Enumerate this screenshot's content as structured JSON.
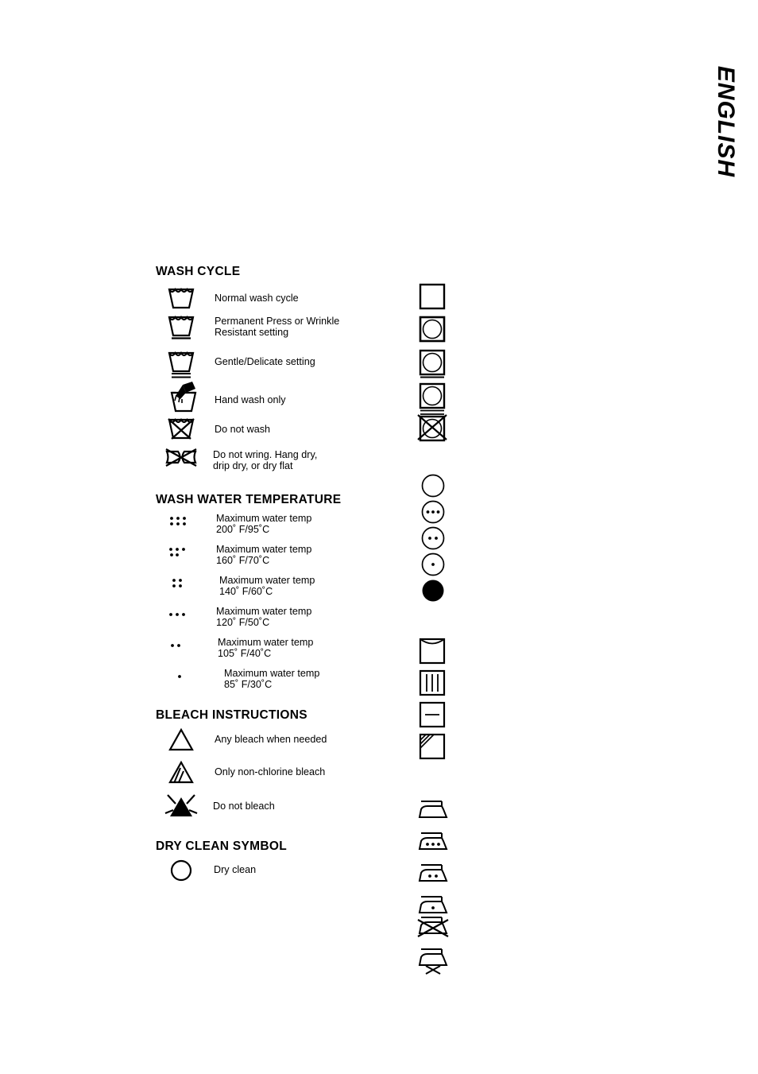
{
  "page": {
    "language_tab": "ENGLISH"
  },
  "sections": [
    {
      "id": "wash-cycle",
      "title": "WASH CYCLE",
      "entries": [
        {
          "icon": "washtub-icon",
          "label": "Normal wash cycle"
        },
        {
          "icon": "washtub-one-bar-icon",
          "label": "Permanent Press or Wrinkle",
          "label2": "Resistant setting"
        },
        {
          "icon": "washtub-two-bar-icon",
          "label": "Gentle/Delicate setting"
        },
        {
          "icon": "washtub-hand-icon",
          "label": "Hand wash only"
        },
        {
          "icon": "washtub-crossed-icon",
          "label": "Do not wash"
        },
        {
          "icon": "do-not-wring-icon",
          "label": "Do not wring. Hang dry,",
          "label2": "drip dry, or dry flat"
        }
      ]
    },
    {
      "id": "wash-water-temperature",
      "title": "WASH WATER TEMPERATURE",
      "entries": [
        {
          "icon": "six-dots-icon",
          "dots": 6,
          "label": "Maximum water temp",
          "label2": "200˚ F/95˚C"
        },
        {
          "icon": "five-dots-icon",
          "dots": 5,
          "label": "Maximum water temp",
          "label2": "160˚ F/70˚C"
        },
        {
          "icon": "four-dots-icon",
          "dots": 4,
          "label": "Maximum water temp",
          "label2": "140˚ F/60˚C"
        },
        {
          "icon": "three-dots-icon",
          "dots": 3,
          "label": "Maximum water temp",
          "label2": "120˚ F/50˚C"
        },
        {
          "icon": "two-dots-icon",
          "dots": 2,
          "label": "Maximum water temp",
          "label2": "105˚ F/40˚C"
        },
        {
          "icon": "one-dot-icon",
          "dots": 1,
          "label": "Maximum water temp",
          "label2": "85˚ F/30˚C"
        }
      ]
    },
    {
      "id": "bleach-instructions",
      "title": "BLEACH INSTRUCTIONS",
      "entries": [
        {
          "icon": "triangle-icon",
          "label": "Any bleach when needed"
        },
        {
          "icon": "triangle-striped-icon",
          "label": "Only non-chlorine bleach"
        },
        {
          "icon": "triangle-filled-icon",
          "label": "Do not bleach"
        }
      ]
    },
    {
      "id": "dry-clean-symbol",
      "title": "DRY CLEAN SYMBOL",
      "entries": [
        {
          "icon": "circle-icon",
          "label": "Dry clean"
        }
      ]
    }
  ],
  "right_column": {
    "tumble_dry": [
      {
        "icon": "square-icon"
      },
      {
        "icon": "tumble-dry-icon"
      },
      {
        "icon": "tumble-dry-one-bar-icon"
      },
      {
        "icon": "tumble-dry-two-bar-icon"
      },
      {
        "icon": "tumble-dry-crossed-icon"
      }
    ],
    "dry_clean": [
      {
        "icon": "dryclean-circle-icon"
      },
      {
        "icon": "dryclean-three-dots-icon",
        "dots": 3
      },
      {
        "icon": "dryclean-two-dots-icon",
        "dots": 2
      },
      {
        "icon": "dryclean-one-dot-icon",
        "dots": 1
      },
      {
        "icon": "dryclean-filled-icon"
      }
    ],
    "line_dry": [
      {
        "icon": "hang-dry-icon"
      },
      {
        "icon": "drip-dry-icon"
      },
      {
        "icon": "dry-flat-icon"
      },
      {
        "icon": "dry-in-shade-icon"
      }
    ],
    "ironing": [
      {
        "icon": "iron-icon"
      },
      {
        "icon": "iron-three-dots-icon",
        "dots": 3
      },
      {
        "icon": "iron-two-dots-icon",
        "dots": 2
      },
      {
        "icon": "iron-one-dot-icon",
        "dots": 1
      },
      {
        "icon": "do-not-iron-icon"
      },
      {
        "icon": "no-steam-iron-icon"
      }
    ]
  }
}
